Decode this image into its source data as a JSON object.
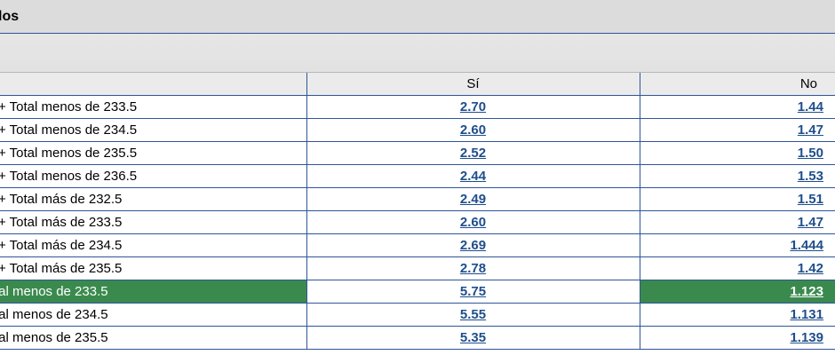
{
  "section": {
    "title": "los"
  },
  "table": {
    "headers": {
      "name": "",
      "yes": "Sí",
      "no": "No"
    },
    "rows": [
      {
        "name": "+ Total menos de 233.5",
        "yes": "2.70",
        "no": "1.44",
        "highlight": false
      },
      {
        "name": "+ Total menos de 234.5",
        "yes": "2.60",
        "no": "1.47",
        "highlight": false
      },
      {
        "name": "+ Total menos de 235.5",
        "yes": "2.52",
        "no": "1.50",
        "highlight": false
      },
      {
        "name": "+ Total menos de 236.5",
        "yes": "2.44",
        "no": "1.53",
        "highlight": false
      },
      {
        "name": "+ Total más de 232.5",
        "yes": "2.49",
        "no": "1.51",
        "highlight": false
      },
      {
        "name": "+ Total más de 233.5",
        "yes": "2.60",
        "no": "1.47",
        "highlight": false
      },
      {
        "name": "+ Total más de 234.5",
        "yes": "2.69",
        "no": "1.444",
        "highlight": false
      },
      {
        "name": "+ Total más de 235.5",
        "yes": "2.78",
        "no": "1.42",
        "highlight": false
      },
      {
        "name": "tal menos de 233.5",
        "yes": "5.75",
        "no": "1.123",
        "highlight": true
      },
      {
        "name": "tal menos de 234.5",
        "yes": "5.55",
        "no": "1.131",
        "highlight": false
      },
      {
        "name": "tal menos de 235.5",
        "yes": "5.35",
        "no": "1.139",
        "highlight": false
      }
    ]
  },
  "colors": {
    "highlight": "#3a8a4e",
    "link": "#1f4e8c",
    "border": "#2f5597",
    "header_bg": "#dcdcdc"
  }
}
